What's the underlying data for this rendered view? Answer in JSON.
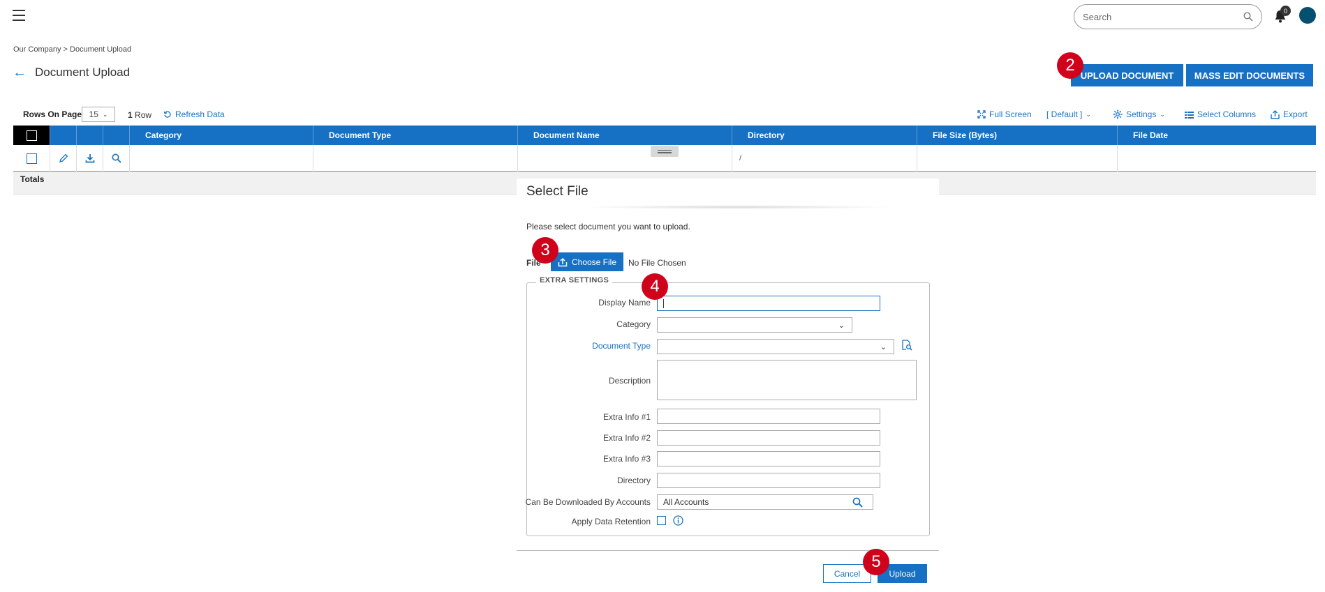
{
  "header": {
    "search_placeholder": "Search",
    "notifications_count": "0"
  },
  "breadcrumb": "Our Company > Document Upload",
  "page_title": "Document Upload",
  "actions": {
    "upload_document": "UPLOAD DOCUMENT",
    "mass_edit_documents": "MASS EDIT DOCUMENTS"
  },
  "step_badges": [
    "2",
    "3",
    "4",
    "5"
  ],
  "toolbar": {
    "rows_on_page_label": "Rows On Page",
    "rows_on_page_value": "15",
    "row_count": "1",
    "row_label": "Row",
    "refresh": "Refresh Data",
    "full_screen": "Full Screen",
    "default_view": "[ Default ]",
    "settings": "Settings",
    "select_columns": "Select Columns",
    "export": "Export"
  },
  "grid": {
    "columns": [
      "Category",
      "Document Type",
      "Document Name",
      "Directory",
      "File Size (Bytes)",
      "File Date"
    ],
    "row": {
      "directory": "/"
    },
    "totals_label": "Totals"
  },
  "modal": {
    "title": "Select File",
    "description": "Please select document you want to upload.",
    "file_label": "File",
    "choose_file": "Choose File",
    "no_file": "No File Chosen",
    "extra_settings": "EXTRA SETTINGS",
    "fields": {
      "display_name": "Display Name",
      "category": "Category",
      "document_type": "Document Type",
      "description": "Description",
      "extra_info_1": "Extra Info #1",
      "extra_info_2": "Extra Info #2",
      "extra_info_3": "Extra Info #3",
      "directory": "Directory",
      "can_be_downloaded_by": "Can Be Downloaded By Accounts",
      "can_be_downloaded_value": "All Accounts",
      "apply_data_retention": "Apply Data Retention"
    },
    "cancel": "Cancel",
    "upload": "Upload"
  },
  "colors": {
    "primary": "#1671c4",
    "badge": "#d0021b",
    "avatar": "#064f6e"
  }
}
